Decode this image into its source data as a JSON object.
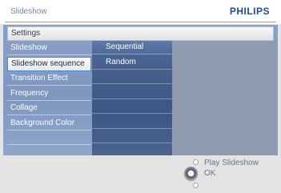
{
  "header": {
    "title": "Slideshow",
    "brand": "PHILIPS"
  },
  "settings": {
    "label": "Settings"
  },
  "menu": {
    "items": [
      {
        "label": "Slideshow",
        "selected": false
      },
      {
        "label": "Slideshow sequence",
        "selected": true
      },
      {
        "label": "Transition Effect",
        "selected": false
      },
      {
        "label": "Frequency",
        "selected": false
      },
      {
        "label": "Collage",
        "selected": false
      },
      {
        "label": "Background Color",
        "selected": false
      },
      {
        "label": "",
        "selected": false
      },
      {
        "label": "",
        "selected": false
      }
    ]
  },
  "submenu": {
    "items": [
      {
        "label": "Sequential",
        "selected": true
      },
      {
        "label": "Random",
        "selected": false
      },
      {
        "label": "",
        "selected": false
      },
      {
        "label": "",
        "selected": false
      },
      {
        "label": "",
        "selected": false
      },
      {
        "label": "",
        "selected": false
      },
      {
        "label": "",
        "selected": false
      },
      {
        "label": "",
        "selected": false
      }
    ]
  },
  "controls": {
    "play_label": "Play Slideshow",
    "ok_label": "OK",
    "up_icon": "nav-up-dot-icon",
    "ok_icon": "ok-button-icon",
    "down_icon": "nav-down-dot-icon"
  }
}
